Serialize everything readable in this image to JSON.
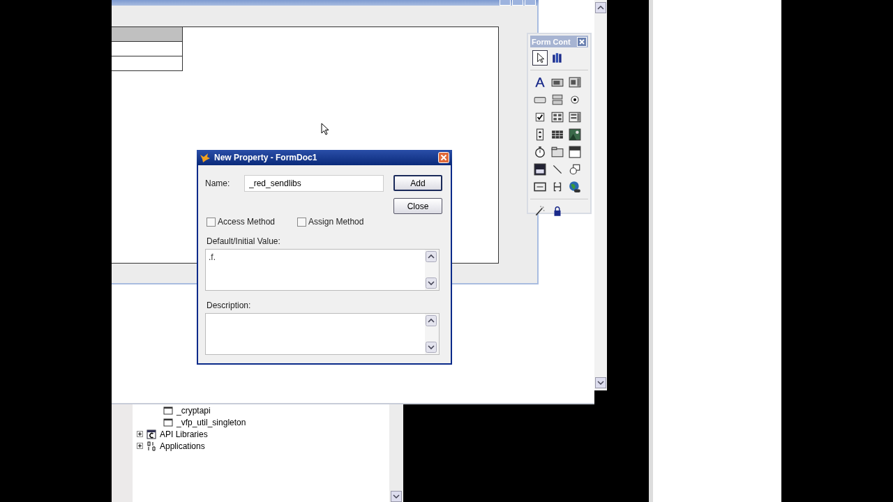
{
  "toolbox": {
    "title": "Form Cont",
    "tools": [
      {
        "kind": "pointer",
        "selected": true
      },
      {
        "kind": "library",
        "selected": false
      },
      {
        "kind": "label",
        "selected": false
      },
      {
        "kind": "textbox",
        "selected": false
      },
      {
        "kind": "editbox",
        "selected": false
      },
      {
        "kind": "button",
        "selected": false
      },
      {
        "kind": "buttongroup",
        "selected": false
      },
      {
        "kind": "option",
        "selected": false
      },
      {
        "kind": "checkbox",
        "selected": false
      },
      {
        "kind": "combobox",
        "selected": false
      },
      {
        "kind": "listbox",
        "selected": false
      },
      {
        "kind": "spinner",
        "selected": false
      },
      {
        "kind": "grid",
        "selected": false
      },
      {
        "kind": "image",
        "selected": false
      },
      {
        "kind": "timer",
        "selected": false
      },
      {
        "kind": "pageframe",
        "selected": false
      },
      {
        "kind": "olecontrol",
        "selected": false
      },
      {
        "kind": "olebound",
        "selected": false
      },
      {
        "kind": "line",
        "selected": false
      },
      {
        "kind": "shape",
        "selected": false
      },
      {
        "kind": "container",
        "selected": false
      },
      {
        "kind": "separator",
        "selected": false
      },
      {
        "kind": "hyperlink",
        "selected": false
      },
      {
        "kind": "builder",
        "selected": false
      },
      {
        "kind": "lock",
        "selected": false
      }
    ]
  },
  "dialog": {
    "title": "New Property - FormDoc1",
    "name_label": "Name:",
    "name_value": "_red_sendlibs",
    "buttons": [
      {
        "label": "Add",
        "default": true
      },
      {
        "label": "Close",
        "default": false
      }
    ],
    "checkboxes": [
      {
        "label": "Access Method",
        "checked": false
      },
      {
        "label": "Assign Method",
        "checked": false
      }
    ],
    "default_label": "Default/Initial Value:",
    "default_value": ".f.",
    "description_label": "Description:"
  },
  "project_tree": {
    "items": [
      {
        "kind": "leaf",
        "label": "_cryptapi"
      },
      {
        "kind": "leaf",
        "label": "_vfp_util_singleton"
      },
      {
        "kind": "group",
        "label": "API Libraries",
        "expanded": false
      },
      {
        "kind": "group",
        "label": "Applications",
        "expanded": false
      }
    ]
  }
}
